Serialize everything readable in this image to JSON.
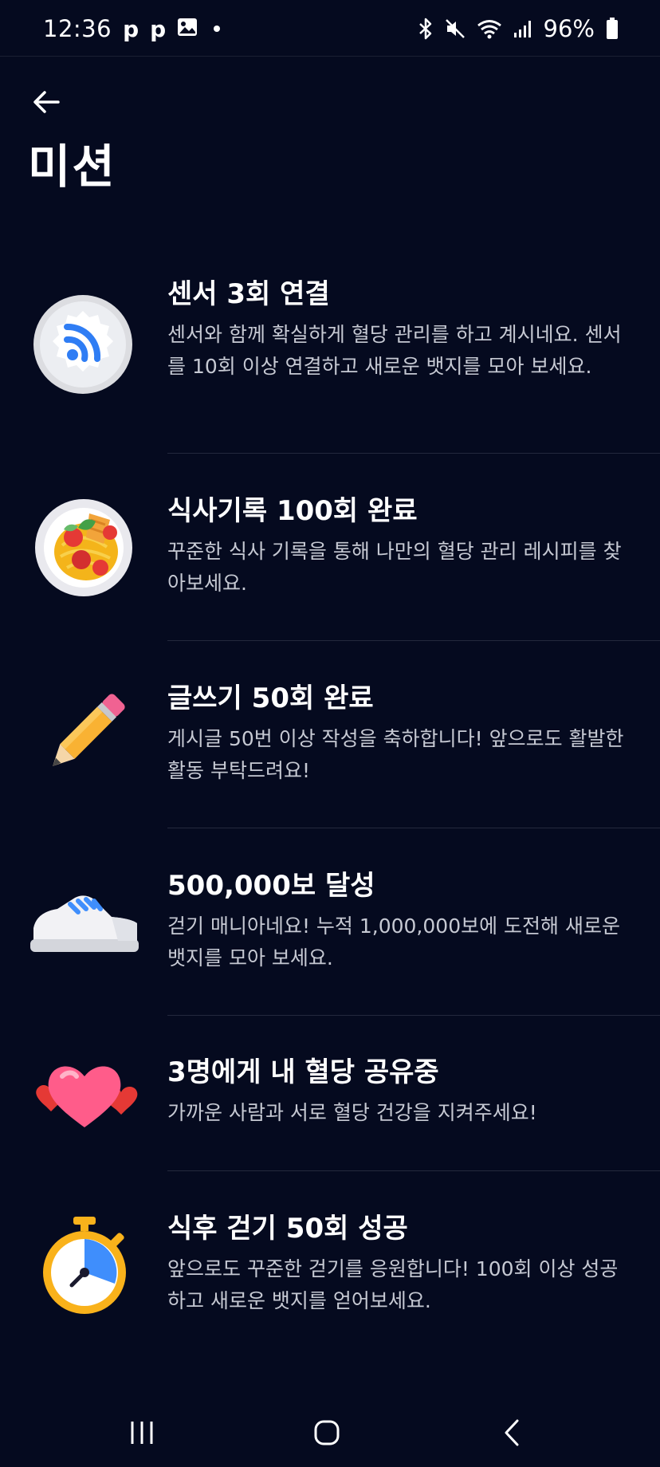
{
  "status_bar": {
    "time": "12:36",
    "notif_1": "p",
    "notif_2": "p",
    "battery": "96%"
  },
  "header": {
    "title": "미션"
  },
  "missions": [
    {
      "title": "센서 3회 연결",
      "description": "센서와 함께 확실하게 혈당 관리를 하고 계시네요. 센서를 10회 이상 연결하고 새로운 뱃지를 모아 보세요.",
      "icon": "sensor-badge-icon"
    },
    {
      "title": "식사기록 100회 완료",
      "description": "꾸준한 식사 기록을 통해 나만의 혈당 관리 레시피를 찾아보세요.",
      "icon": "pasta-plate-icon"
    },
    {
      "title": "글쓰기 50회 완료",
      "description": "게시글 50번 이상 작성을 축하합니다! 앞으로도 활발한 활동 부탁드려요!",
      "icon": "pencil-icon"
    },
    {
      "title": "500,000보 달성",
      "description": "걷기 매니아네요! 누적 1,000,000보에 도전해 새로운 뱃지를 모아 보세요.",
      "icon": "sneaker-icon"
    },
    {
      "title": "3명에게 내 혈당 공유중",
      "description": "가까운 사람과 서로 혈당 건강을 지켜주세요!",
      "icon": "hearts-icon"
    },
    {
      "title": "식후 걷기 50회 성공",
      "description": "앞으로도 꾸준한 걷기를 응원합니다! 100회 이상 성공하고 새로운 뱃지를 얻어보세요.",
      "icon": "stopwatch-icon"
    }
  ],
  "colors": {
    "background": "#050a1f",
    "text_primary": "#ffffff",
    "text_secondary": "#c6c9d3",
    "divider": "#24293d"
  }
}
